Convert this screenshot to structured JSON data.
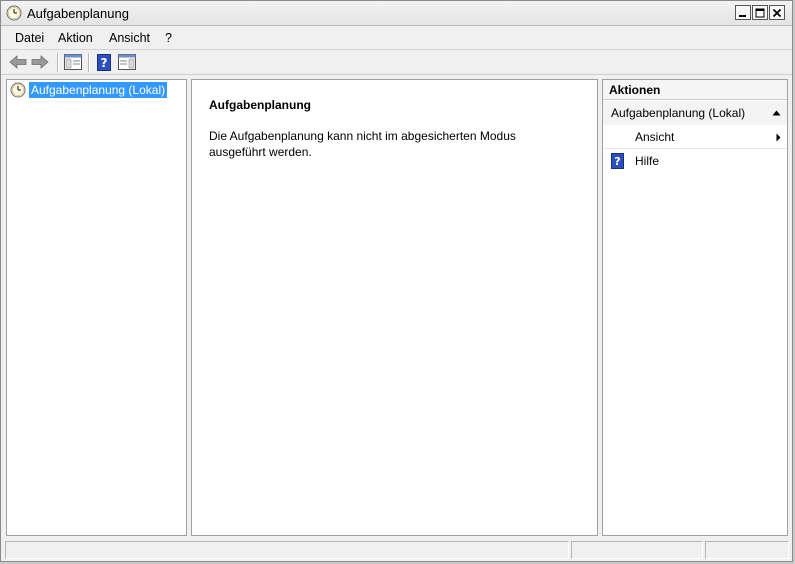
{
  "window": {
    "title": "Aufgabenplanung"
  },
  "menu": {
    "items": [
      "Datei",
      "Aktion",
      "Ansicht",
      "?"
    ]
  },
  "tree": {
    "root_label": "Aufgabenplanung (Lokal)"
  },
  "center": {
    "title": "Aufgabenplanung",
    "message": "Die Aufgabenplanung kann nicht im abgesicherten Modus ausgeführt werden."
  },
  "actions": {
    "header": "Aktionen",
    "section_label": "Aufgabenplanung (Lokal)",
    "items": [
      {
        "label": "Ansicht",
        "icon": "none",
        "has_submenu": true
      },
      {
        "label": "Hilfe",
        "icon": "help-icon",
        "has_submenu": false
      }
    ]
  },
  "colors": {
    "selection": "#3399ff",
    "help_icon": "#2c4fc0"
  }
}
